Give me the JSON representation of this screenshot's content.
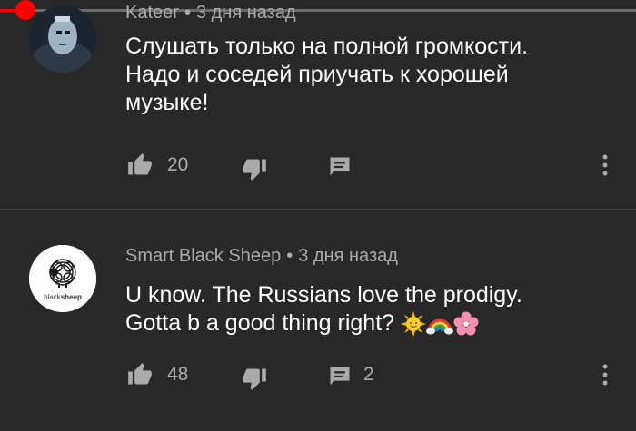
{
  "player": {
    "progress_percent": 4
  },
  "comments": [
    {
      "author": "Kateer",
      "time": "3 дня назад",
      "lines": [
        "Слушать только на полной громкости.",
        "Надо и соседей приучать к хорошей",
        "музыке!"
      ],
      "likes": "20",
      "replies": ""
    },
    {
      "author": "Smart Black Sheep",
      "time": "3 дня назад",
      "lines": [
        "U know. The Russians love the prodigy.",
        "Gotta b a good thing right?"
      ],
      "emojis": [
        "sun-with-face-icon",
        "rainbow-icon",
        "cherry-blossom-icon"
      ],
      "avatar_text_light": "black",
      "avatar_text_bold": "sheep",
      "likes": "48",
      "replies": "2"
    }
  ],
  "separator": "•",
  "colors": {
    "background": "#282828",
    "secondary_text": "#aaaaaa",
    "progress": "#ff0000"
  }
}
